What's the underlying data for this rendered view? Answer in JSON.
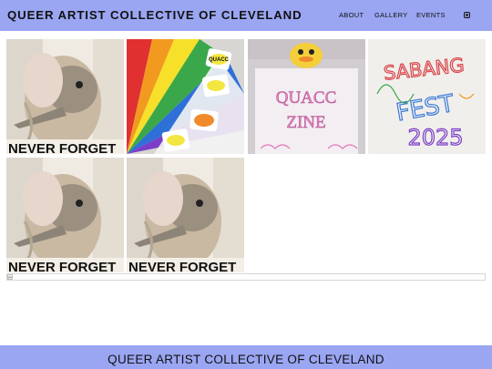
{
  "header": {
    "title": "QUEER ARTIST COLLECTIVE OF CLEVELAND",
    "nav": [
      {
        "label": "ABOUT"
      },
      {
        "label": "GALLERY"
      },
      {
        "label": "EVENTS"
      }
    ],
    "social_icon": "instagram-icon"
  },
  "gallery": {
    "items": [
      {
        "image": "never-forget-bird",
        "caption": "NEVER FORGET"
      },
      {
        "image": "rainbow-fan-stickers",
        "sticker_text": "QUACC"
      },
      {
        "image": "quacc-zine-duck",
        "line1": "QUACC",
        "line2": "ZINE"
      },
      {
        "image": "sabang-fest-2025",
        "line1": "SABANG",
        "line2": "FEST",
        "year": "2025"
      },
      {
        "image": "never-forget-bird",
        "caption": "NEVER FORGET"
      },
      {
        "image": "never-forget-bird",
        "caption": "NEVER FORGET"
      }
    ],
    "broken_image_icon": "broken-image-icon"
  },
  "footer": {
    "title": "QUEER ARTIST COLLECTIVE OF CLEVELAND"
  },
  "colors": {
    "header_bg": "#9aa6f2",
    "footer_bg": "#9aa6f2",
    "page_bg": "#ffffff"
  }
}
